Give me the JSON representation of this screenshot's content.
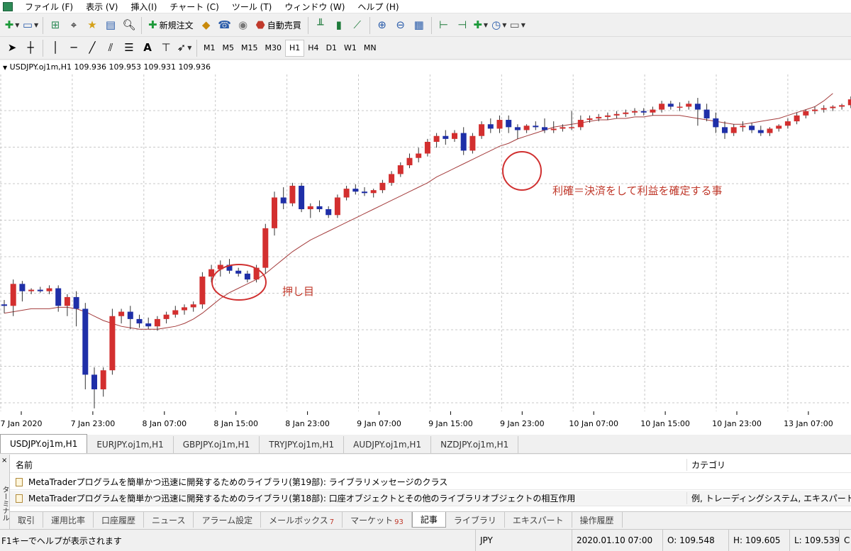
{
  "menu": [
    "ファイル (F)",
    "表示 (V)",
    "挿入(I)",
    "チャート (C)",
    "ツール (T)",
    "ウィンドウ (W)",
    "ヘルプ (H)"
  ],
  "toolbar": {
    "new_order": "新規注文",
    "auto_trade": "自動売買"
  },
  "toolbar2": {
    "text_tool": "A"
  },
  "periods": [
    "M1",
    "M5",
    "M15",
    "M30",
    "H1",
    "H4",
    "D1",
    "W1",
    "MN"
  ],
  "active_period": "H1",
  "chart_info": "USDJPY.oj1m,H1  109.936 109.953 109.931 109.936",
  "annotations": {
    "pullback": "押し目",
    "take_profit": "利確＝決済をして利益を確定する事"
  },
  "chart_data": {
    "type": "candlestick",
    "symbol": "USDJPY.oj1m",
    "timeframe": "H1",
    "info_ohlc": {
      "open": 109.936,
      "high": 109.953,
      "low": 109.931,
      "close": 109.936
    },
    "x_ticks": [
      "7 Jan 2020",
      "7 Jan 23:00",
      "8 Jan 07:00",
      "8 Jan 15:00",
      "8 Jan 23:00",
      "9 Jan 07:00",
      "9 Jan 15:00",
      "9 Jan 23:00",
      "10 Jan 07:00",
      "10 Jan 15:00",
      "10 Jan 23:00",
      "13 Jan 07:00"
    ],
    "y_range": [
      107.8,
      110.1
    ],
    "grid": true,
    "up_color": "#d32f2f",
    "down_color": "#1f2fa8",
    "ma_color": "#a43c3c",
    "candles": [
      [
        108.53,
        108.56,
        108.47,
        108.52
      ],
      [
        108.52,
        108.7,
        108.45,
        108.67
      ],
      [
        108.67,
        108.69,
        108.55,
        108.62
      ],
      [
        108.62,
        108.64,
        108.6,
        108.63
      ],
      [
        108.63,
        108.65,
        108.61,
        108.62
      ],
      [
        108.62,
        108.66,
        108.6,
        108.64
      ],
      [
        108.64,
        108.66,
        108.48,
        108.52
      ],
      [
        108.52,
        108.6,
        108.45,
        108.58
      ],
      [
        108.58,
        108.62,
        108.38,
        108.5
      ],
      [
        108.5,
        108.54,
        107.95,
        108.05
      ],
      [
        108.05,
        108.1,
        107.82,
        107.95
      ],
      [
        107.95,
        108.1,
        107.9,
        108.08
      ],
      [
        108.08,
        108.5,
        108.05,
        108.45
      ],
      [
        108.45,
        108.5,
        108.4,
        108.48
      ],
      [
        108.48,
        108.52,
        108.36,
        108.43
      ],
      [
        108.43,
        108.46,
        108.37,
        108.4
      ],
      [
        108.4,
        108.44,
        108.36,
        108.38
      ],
      [
        108.38,
        108.45,
        108.35,
        108.43
      ],
      [
        108.43,
        108.48,
        108.4,
        108.46
      ],
      [
        108.46,
        108.52,
        108.44,
        108.49
      ],
      [
        108.49,
        108.53,
        108.46,
        108.51
      ],
      [
        108.51,
        108.55,
        108.48,
        108.53
      ],
      [
        108.53,
        108.75,
        108.5,
        108.72
      ],
      [
        108.72,
        108.8,
        108.68,
        108.77
      ],
      [
        108.77,
        108.83,
        108.72,
        108.8
      ],
      [
        108.8,
        108.84,
        108.74,
        108.76
      ],
      [
        108.76,
        108.78,
        108.72,
        108.74
      ],
      [
        108.74,
        108.76,
        108.68,
        108.7
      ],
      [
        108.7,
        108.8,
        108.68,
        108.78
      ],
      [
        108.78,
        109.08,
        108.74,
        109.05
      ],
      [
        109.05,
        109.3,
        109.0,
        109.26
      ],
      [
        109.26,
        109.33,
        109.18,
        109.22
      ],
      [
        109.22,
        109.36,
        109.2,
        109.34
      ],
      [
        109.34,
        109.36,
        109.16,
        109.18
      ],
      [
        109.18,
        109.22,
        109.12,
        109.2
      ],
      [
        109.2,
        109.24,
        109.16,
        109.18
      ],
      [
        109.18,
        109.2,
        109.12,
        109.14
      ],
      [
        109.14,
        109.28,
        109.12,
        109.26
      ],
      [
        109.26,
        109.34,
        109.24,
        109.32
      ],
      [
        109.32,
        109.35,
        109.28,
        109.3
      ],
      [
        109.3,
        109.33,
        109.27,
        109.29
      ],
      [
        109.29,
        109.32,
        109.26,
        109.31
      ],
      [
        109.31,
        109.38,
        109.29,
        109.36
      ],
      [
        109.36,
        109.44,
        109.34,
        109.42
      ],
      [
        109.42,
        109.5,
        109.4,
        109.48
      ],
      [
        109.48,
        109.56,
        109.46,
        109.53
      ],
      [
        109.53,
        109.6,
        109.5,
        109.56
      ],
      [
        109.56,
        109.66,
        109.54,
        109.64
      ],
      [
        109.64,
        109.7,
        109.6,
        109.68
      ],
      [
        109.68,
        109.72,
        109.62,
        109.66
      ],
      [
        109.66,
        109.72,
        109.64,
        109.7
      ],
      [
        109.7,
        109.74,
        109.55,
        109.58
      ],
      [
        109.58,
        109.7,
        109.56,
        109.68
      ],
      [
        109.68,
        109.78,
        109.66,
        109.76
      ],
      [
        109.76,
        109.8,
        109.7,
        109.73
      ],
      [
        109.73,
        109.82,
        109.7,
        109.79
      ],
      [
        109.79,
        109.82,
        109.7,
        109.74
      ],
      [
        109.74,
        109.76,
        109.66,
        109.72
      ],
      [
        109.72,
        109.76,
        109.7,
        109.75
      ],
      [
        109.75,
        109.78,
        109.72,
        109.74
      ],
      [
        109.74,
        109.8,
        109.7,
        109.72
      ],
      [
        109.72,
        109.78,
        109.7,
        109.73
      ],
      [
        109.73,
        109.76,
        109.71,
        109.74
      ],
      [
        109.74,
        109.85,
        109.72,
        109.74
      ],
      [
        109.74,
        109.82,
        109.72,
        109.79
      ],
      [
        109.79,
        109.82,
        109.77,
        109.8
      ],
      [
        109.8,
        109.83,
        109.78,
        109.81
      ],
      [
        109.81,
        109.84,
        109.79,
        109.82
      ],
      [
        109.82,
        109.85,
        109.8,
        109.83
      ],
      [
        109.83,
        109.86,
        109.81,
        109.84
      ],
      [
        109.84,
        109.87,
        109.82,
        109.85
      ],
      [
        109.85,
        109.87,
        109.82,
        109.84
      ],
      [
        109.84,
        109.88,
        109.82,
        109.86
      ],
      [
        109.86,
        109.92,
        109.84,
        109.9
      ],
      [
        109.9,
        109.92,
        109.86,
        109.88
      ],
      [
        109.88,
        109.91,
        109.85,
        109.88
      ],
      [
        109.88,
        109.92,
        109.86,
        109.9
      ],
      [
        109.9,
        109.94,
        109.75,
        109.86
      ],
      [
        109.86,
        109.9,
        109.78,
        109.8
      ],
      [
        109.8,
        109.84,
        109.7,
        109.74
      ],
      [
        109.74,
        109.78,
        109.66,
        109.7
      ],
      [
        109.7,
        109.76,
        109.68,
        109.74
      ],
      [
        109.74,
        109.78,
        109.71,
        109.75
      ],
      [
        109.75,
        109.77,
        109.7,
        109.72
      ],
      [
        109.72,
        109.75,
        109.68,
        109.7
      ],
      [
        109.7,
        109.74,
        109.68,
        109.73
      ],
      [
        109.73,
        109.76,
        109.71,
        109.75
      ],
      [
        109.75,
        109.8,
        109.73,
        109.78
      ],
      [
        109.78,
        109.84,
        109.76,
        109.82
      ],
      [
        109.82,
        109.86,
        109.8,
        109.85
      ],
      [
        109.85,
        109.88,
        109.83,
        109.86
      ],
      [
        109.86,
        109.89,
        109.84,
        109.87
      ],
      [
        109.87,
        109.89,
        109.85,
        109.88
      ],
      [
        109.88,
        109.9,
        109.86,
        109.89
      ],
      [
        109.89,
        109.95,
        109.87,
        109.93
      ],
      [
        109.93,
        110.12,
        109.91,
        110.08
      ],
      [
        110.08,
        110.14,
        110.02,
        110.12
      ],
      [
        110.12,
        110.14,
        110.04,
        110.08
      ],
      [
        110.08,
        110.13,
        110.04,
        110.11
      ]
    ],
    "ma": [
      108.47,
      108.48,
      108.49,
      108.5,
      108.5,
      108.5,
      108.51,
      108.51,
      108.5,
      108.48,
      108.45,
      108.42,
      108.4,
      108.38,
      108.37,
      108.36,
      108.36,
      108.36,
      108.37,
      108.38,
      108.4,
      108.43,
      108.47,
      108.52,
      108.57,
      108.61,
      108.64,
      108.67,
      108.7,
      108.74,
      108.79,
      108.84,
      108.89,
      108.93,
      108.97,
      109.0,
      109.03,
      109.06,
      109.09,
      109.12,
      109.15,
      109.18,
      109.21,
      109.24,
      109.27,
      109.3,
      109.33,
      109.36,
      109.4,
      109.43,
      109.46,
      109.49,
      109.52,
      109.55,
      109.58,
      109.61,
      109.63,
      109.66,
      109.68,
      109.7,
      109.72,
      109.74,
      109.75,
      109.76,
      109.77,
      109.78,
      109.79,
      109.79,
      109.8,
      109.8,
      109.81,
      109.81,
      109.82,
      109.82,
      109.82,
      109.82,
      109.81,
      109.8,
      109.79,
      109.78,
      109.77,
      109.76,
      109.76,
      109.77,
      109.78,
      109.79,
      109.8,
      109.82,
      109.84,
      109.86,
      109.88,
      109.92,
      109.97
    ]
  },
  "chart_tabs": [
    "USDJPY.oj1m,H1",
    "EURJPY.oj1m,H1",
    "GBPJPY.oj1m,H1",
    "TRYJPY.oj1m,H1",
    "AUDJPY.oj1m,H1",
    "NZDJPY.oj1m,H1"
  ],
  "terminal": {
    "side_label": "ターミナル",
    "close": "×",
    "columns": {
      "name": "名前",
      "category": "カテゴリ"
    },
    "rows": [
      {
        "name": "MetaTraderプログラムを簡単かつ迅速に開発するためのライブラリ(第19部): ライブラリメッセージのクラス",
        "category": ""
      },
      {
        "name": "MetaTraderプログラムを簡単かつ迅速に開発するためのライブラリ(第18部): 口座オブジェクトとその他のライブラリオブジェクトの相互作用",
        "category": "例, トレーディングシステム, エキスパートアド"
      }
    ],
    "extra_category": "例, トレーディングシステム, エキスパートアド",
    "tabs": [
      {
        "label": "取引",
        "badge": ""
      },
      {
        "label": "運用比率",
        "badge": ""
      },
      {
        "label": "口座履歴",
        "badge": ""
      },
      {
        "label": "ニュース",
        "badge": ""
      },
      {
        "label": "アラーム設定",
        "badge": ""
      },
      {
        "label": "メールボックス",
        "badge": "7"
      },
      {
        "label": "マーケット",
        "badge": "93"
      },
      {
        "label": "記事",
        "badge": ""
      },
      {
        "label": "ライブラリ",
        "badge": ""
      },
      {
        "label": "エキスパート",
        "badge": ""
      },
      {
        "label": "操作履歴",
        "badge": ""
      }
    ],
    "active_tab": "記事"
  },
  "status": {
    "help": "F1キーでヘルプが表示されます",
    "currency": "JPY",
    "datetime": "2020.01.10 07:00",
    "open": "O: 109.548",
    "high": "H: 109.605",
    "low": "L: 109.539",
    "close": "C"
  }
}
